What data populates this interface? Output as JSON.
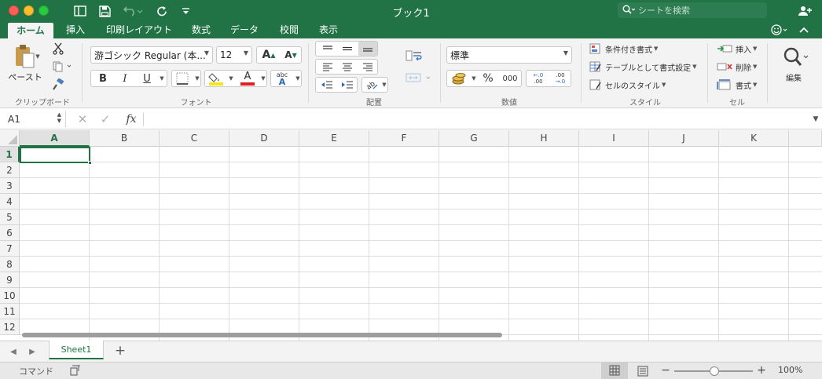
{
  "window": {
    "title": "ブック1",
    "search_placeholder": "シートを検索"
  },
  "titlebar_icons": [
    "sidebar-icon",
    "save-icon",
    "undo-icon",
    "redo-icon",
    "customize-icon"
  ],
  "tabs": [
    {
      "label": "ホーム",
      "active": true
    },
    {
      "label": "挿入"
    },
    {
      "label": "印刷レイアウト"
    },
    {
      "label": "数式"
    },
    {
      "label": "データ"
    },
    {
      "label": "校閲"
    },
    {
      "label": "表示"
    }
  ],
  "clipboard": {
    "paste_label": "ペースト",
    "group_label": "クリップボード"
  },
  "font": {
    "name": "游ゴシック Regular (本...",
    "size": "12",
    "bold": "B",
    "italic": "I",
    "underline": "U",
    "grow": "A",
    "shrink": "A",
    "color_a": "A",
    "abc": "abc",
    "abc_a": "A",
    "group_label": "フォント"
  },
  "alignment": {
    "group_label": "配置"
  },
  "number": {
    "format": "標準",
    "percent": "%",
    "comma": "000",
    "inc_decimal_top": "←.0",
    "inc_decimal_bot": ".00",
    "dec_decimal_top": ".00",
    "dec_decimal_bot": "→.0",
    "group_label": "数値"
  },
  "styles": {
    "conditional": "条件付き書式",
    "as_table": "テーブルとして書式設定",
    "cell_styles": "セルのスタイル",
    "group_label": "スタイル"
  },
  "cells": {
    "insert": "挿入",
    "delete": "削除",
    "format": "書式",
    "group_label": "セル"
  },
  "editing": {
    "label": "編集"
  },
  "formula_bar": {
    "name_box": "A1",
    "fx": "fx",
    "value": ""
  },
  "grid": {
    "columns": [
      "A",
      "B",
      "C",
      "D",
      "E",
      "F",
      "G",
      "H",
      "I",
      "J",
      "K"
    ],
    "rows": [
      "1",
      "2",
      "3",
      "4",
      "5",
      "6",
      "7",
      "8",
      "9",
      "10",
      "11",
      "12"
    ],
    "selected_cell": "A1"
  },
  "sheets": [
    {
      "label": "Sheet1",
      "active": true
    }
  ],
  "add_sheet": "+",
  "status": {
    "mode": "コマンド",
    "zoom": "100%",
    "zoom_minus": "−",
    "zoom_plus": "+"
  },
  "colors": {
    "accent": "#217346",
    "ribbon_bg": "#f3f3f3"
  }
}
